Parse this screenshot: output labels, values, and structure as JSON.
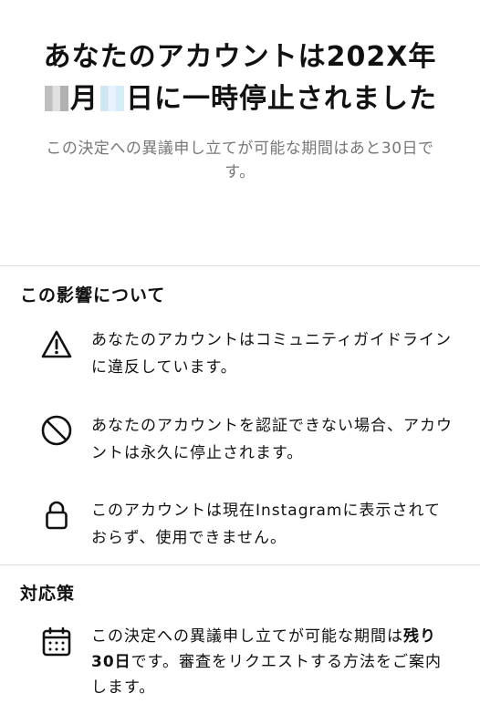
{
  "header": {
    "title_part1": "あなたのアカウントは202X年",
    "title_part2": "月",
    "title_part3": "日に一時停止されました",
    "subtitle": "この決定への異議申し立てが可能な期間はあと30日です。"
  },
  "impact_section": {
    "title": "この影響について",
    "items": [
      {
        "icon": "warning-icon",
        "text": "あなたのアカウントはコミュニティガイドラインに違反しています。"
      },
      {
        "icon": "block-icon",
        "text": "あなたのアカウントを認証できない場合、アカウントは永久に停止されます。"
      },
      {
        "icon": "lock-icon",
        "text": "このアカウントは現在Instagramに表示されておらず、使用できません。"
      }
    ]
  },
  "action_section": {
    "title": "対応策",
    "items": [
      {
        "icon": "calendar-icon",
        "text_before": "この決定への異議申し立てが可能な期間は",
        "text_bold": "残り30日",
        "text_after": "です。審査をリクエストする方法をご案内します。"
      }
    ]
  }
}
